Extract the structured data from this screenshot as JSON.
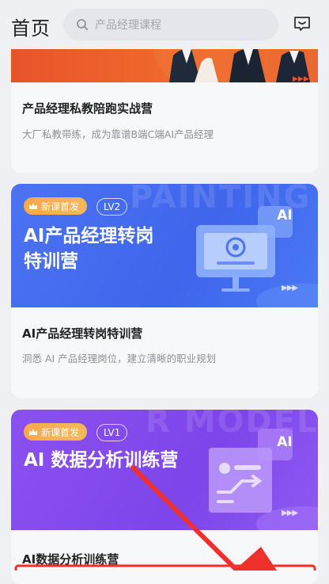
{
  "header": {
    "title": "首页",
    "search_placeholder": "产品经理课程"
  },
  "cards": [
    {
      "title": "产品经理私教陪跑实战营",
      "subtitle": "大厂私教带练，成为靠谱B端C端AI产品经理"
    },
    {
      "badge_new": "新课首发",
      "level": "LV2",
      "banner_heading_line1": "AI产品经理转岗",
      "banner_heading_line2": "特训营",
      "watermark": "PAINTING",
      "icon_label": "AI",
      "title": "AI产品经理转岗特训营",
      "subtitle": "洞悉 AI 产品经理岗位，建立清晰的职业规划"
    },
    {
      "badge_new": "新课首发",
      "level": "LV1",
      "banner_heading": "AI 数据分析训练营",
      "watermark": "R MODEL",
      "icon_label": "AI",
      "title": "AI数据分析训练营"
    }
  ],
  "colors": {
    "card1_banner": "#e8542a",
    "card2_banner": "#4168ee",
    "card3_banner": "#8248ed",
    "badge": "#f6ae50",
    "annotation_arrow": "#f0302a"
  }
}
